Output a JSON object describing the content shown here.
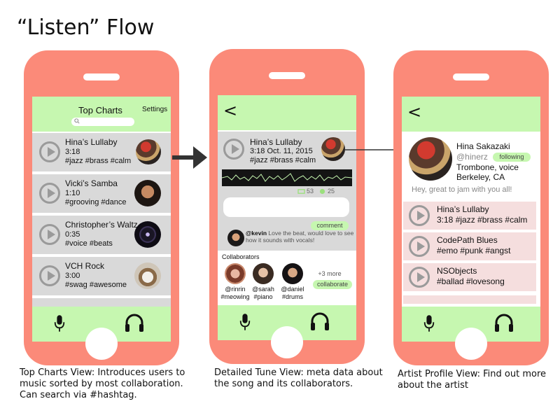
{
  "title": "“Listen” Flow",
  "colors": {
    "phone": "#fb8a79",
    "bar": "#c6f7b0",
    "row": "#d9d9d9",
    "profile_row": "#f5dede"
  },
  "top_charts": {
    "header_title": "Top Charts",
    "settings_label": "Settings",
    "songs": [
      {
        "title": "Hina’s Lullaby",
        "duration": "3:18",
        "tags": "#jazz #brass #calm"
      },
      {
        "title": "Vicki’s Samba",
        "duration": "1:10",
        "tags": "#grooving #dance"
      },
      {
        "title": "Christopher’s Waltz",
        "duration": "0:35",
        "tags": "#voice #beats"
      },
      {
        "title": "VCH Rock",
        "duration": "3:00",
        "tags": "#swag #awesome"
      }
    ],
    "caption": "Top Charts View: Introduces users to music sorted by most collaboration. Can search via #hashtag."
  },
  "detail": {
    "back": "<",
    "song_title": "Hina’s Lullaby",
    "duration_date": "3:18  Oct. 11, 2015",
    "tags": "#jazz #brass #calm",
    "shares": "53",
    "likes": "25",
    "comment_button": "comment",
    "comment_user": "@kevin",
    "comment_text": "Love the beat, would love to see how it sounds with vocals!",
    "collaborators_label": "Collaborators",
    "collaborators": [
      {
        "handle": "@rinrin",
        "tags": "#meowing"
      },
      {
        "handle": "@sarah",
        "tags": "#piano"
      },
      {
        "handle": "@daniel",
        "tags": "#drums"
      }
    ],
    "more": "+3 more",
    "collaborate_button": "collaborate",
    "caption": "Detailed Tune View: meta data about the song and its collaborators."
  },
  "profile": {
    "back": "<",
    "name": "Hina Sakazaki",
    "handle": "@hinerz",
    "following": "following",
    "instruments": "Trombone, voice",
    "location": "Berkeley, CA",
    "bio": "Hey, great to jam with you all!",
    "songs": [
      {
        "title": "Hina’s Lullaby",
        "meta": "3:18 #jazz #brass #calm"
      },
      {
        "title": "CodePath Blues",
        "meta": "#emo #punk #angst"
      },
      {
        "title": "NSObjects",
        "meta": "#ballad #lovesong"
      }
    ],
    "caption": "Artist Profile View: Find out more about the artist"
  }
}
